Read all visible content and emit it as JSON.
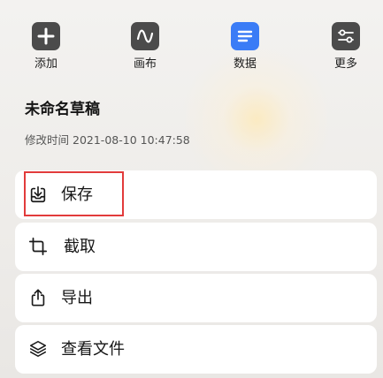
{
  "toolbar": {
    "items": [
      {
        "label": "添加",
        "icon": "plus-icon",
        "color": "#4b4b4b"
      },
      {
        "label": "画布",
        "icon": "wave-icon",
        "color": "#4b4b4b"
      },
      {
        "label": "数据",
        "icon": "list-icon",
        "color": "#3a7cf6"
      },
      {
        "label": "更多",
        "icon": "sliders-icon",
        "color": "#4b4b4b"
      }
    ]
  },
  "draft": {
    "title": "未命名草稿",
    "modified_label": "修改时间",
    "modified_time": "2021-08-10 10:47:58"
  },
  "menu": {
    "items": [
      {
        "label": "保存",
        "icon": "save-icon"
      },
      {
        "label": "截取",
        "icon": "crop-icon"
      },
      {
        "label": "导出",
        "icon": "share-icon"
      },
      {
        "label": "查看文件",
        "icon": "layers-icon"
      }
    ]
  },
  "highlight_color": "#e23b3b"
}
